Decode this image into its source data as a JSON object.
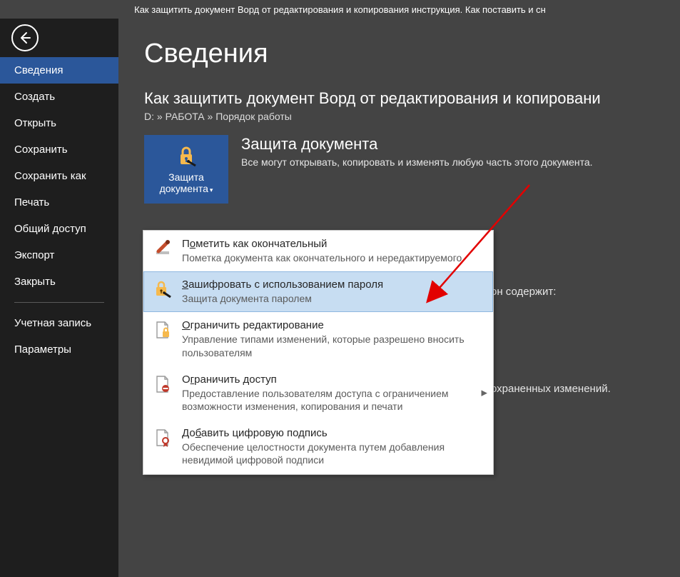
{
  "window_title": "Как защитить документ Ворд от редактирования и копирования инструкция. Как поставить и сн",
  "sidebar": {
    "items": [
      "Сведения",
      "Создать",
      "Открыть",
      "Сохранить",
      "Сохранить как",
      "Печать",
      "Общий доступ",
      "Экспорт",
      "Закрыть"
    ],
    "items2": [
      "Учетная запись",
      "Параметры"
    ],
    "active_index": 0
  },
  "page": {
    "title": "Сведения",
    "doc_title": "Как защитить документ Ворд от редактирования и копировани",
    "breadcrumb": "D: » РАБОТА » Порядок работы"
  },
  "protect_button": {
    "line1": "Защита",
    "line2": "документа"
  },
  "protect_section": {
    "heading": "Защита документа",
    "desc": "Все могут открывать, копировать и изменять любую часть этого документа."
  },
  "bg_text": {
    "line1_tail": "он содержит:",
    "line2_tail": "охраненных изменений."
  },
  "menu": {
    "items": [
      {
        "title_pre": "П",
        "title_ul": "о",
        "title_post": "метить как окончательный",
        "desc": "Пометка документа как окончательного и нередактируемого",
        "has_arrow": false
      },
      {
        "title_pre": "",
        "title_ul": "З",
        "title_post": "ашифровать с использованием пароля",
        "desc": "Защита документа паролем",
        "has_arrow": false
      },
      {
        "title_pre": "",
        "title_ul": "О",
        "title_post": "граничить редактирование",
        "desc": "Управление типами изменений, которые разрешено вносить пользователям",
        "has_arrow": false
      },
      {
        "title_pre": "О",
        "title_ul": "г",
        "title_post": "раничить доступ",
        "desc": "Предоставление пользователям доступа с ограничением возможности изменения, копирования и печати",
        "has_arrow": true
      },
      {
        "title_pre": "До",
        "title_ul": "б",
        "title_post": "авить цифровую подпись",
        "desc": "Обеспечение целостности документа путем добавления невидимой цифровой подписи",
        "has_arrow": false
      }
    ],
    "hover_index": 1
  }
}
